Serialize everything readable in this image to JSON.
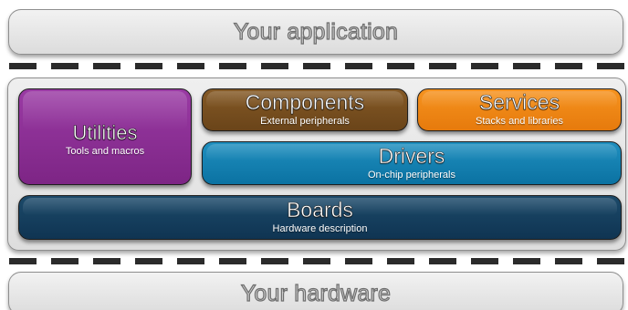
{
  "layers": {
    "application": {
      "label": "Your application",
      "color": "#e6e6e6"
    },
    "hardware": {
      "label": "Your hardware",
      "color": "#e6e6e6"
    }
  },
  "blocks": {
    "utilities": {
      "title": "Utilities",
      "subtitle": "Tools and macros",
      "color": "#8a2f93"
    },
    "components": {
      "title": "Components",
      "subtitle": "External peripherals",
      "color": "#7a5020"
    },
    "services": {
      "title": "Services",
      "subtitle": "Stacks and libraries",
      "color": "#f28a16"
    },
    "drivers": {
      "title": "Drivers",
      "subtitle": "On-chip peripherals",
      "color": "#1582b5"
    },
    "boards": {
      "title": "Boards",
      "subtitle": "Hardware description",
      "color": "#163f5e"
    }
  },
  "separator_color": "#2b2b2b"
}
